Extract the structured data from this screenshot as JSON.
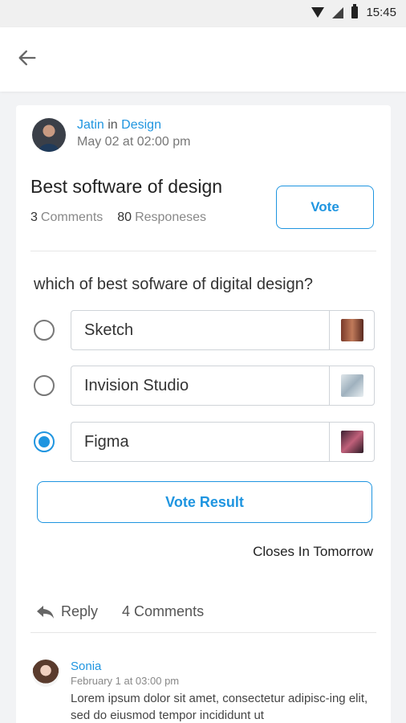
{
  "status_bar": {
    "time": "15:45"
  },
  "post": {
    "author": "Jatin",
    "in_word": "in",
    "category": "Design",
    "date": "May 02 at 02:00 pm",
    "title": "Best software of design",
    "comments_count": "3",
    "comments_label": "Comments",
    "responses_count": "80",
    "responses_label": "Responeses",
    "vote_label": "Vote"
  },
  "poll": {
    "question": "which of best sofware of digital design?",
    "options": [
      {
        "label": "Sketch",
        "selected": false,
        "thumb_color": "#8a4a3a"
      },
      {
        "label": "Invision Studio",
        "selected": false,
        "thumb_color": "#aab8c4"
      },
      {
        "label": "Figma",
        "selected": true,
        "thumb_color": "#6a2f4a"
      }
    ],
    "vote_result_label": "Vote Result",
    "closes_text": "Closes In Tomorrow"
  },
  "actions": {
    "reply_label": "Reply",
    "comments_label": "4 Comments"
  },
  "comment": {
    "name": "Sonia",
    "date": "February 1 at 03:00 pm",
    "text": "Lorem ipsum dolor sit amet, consectetur adipisc-ing elit, sed do eiusmod tempor incididunt ut"
  },
  "colors": {
    "accent": "#1f95e0"
  }
}
